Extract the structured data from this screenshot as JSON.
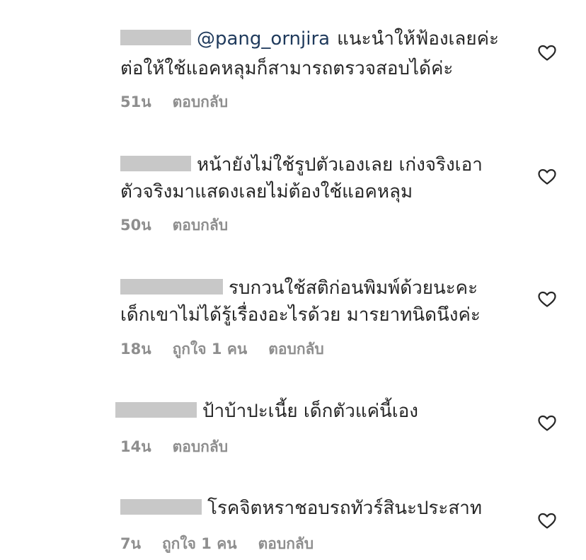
{
  "comments": [
    {
      "mention": "@pang_ornjira",
      "line1": "แนะนำให้ฟ้องเลยค่ะ",
      "line2": "ต่อให้ใช้แอคหลุมก็สามารถตรวจสอบได้ค่ะ",
      "time": "51น",
      "likes": "",
      "reply": "ตอบกลับ"
    },
    {
      "line1": "หน้ายังไม่ใช้รูปตัวเองเลย เก่งจริงเอา",
      "line2": "ตัวจริงมาแสดงเลยไม่ต้องใช้แอคหลุม",
      "time": "50น",
      "likes": "",
      "reply": "ตอบกลับ"
    },
    {
      "line1": "รบกวนใช้สติก่อนพิมพ์ด้วยนะคะ",
      "line2": "เด็กเขาไม่ได้รู้เรื่องอะไรด้วย มารยาทนิดนึงค่ะ",
      "time": "18น",
      "likes": "ถูกใจ 1 คน",
      "reply": "ตอบกลับ"
    },
    {
      "line1": "ป้าบ้าปะเนี้ย เด็กตัวแค่นี้เอง",
      "line2": "",
      "time": "14น",
      "likes": "",
      "reply": "ตอบกลับ"
    },
    {
      "line1": "โรคจิตหราชอบรถทัวร์สินะประสาท",
      "line2": "",
      "time": "7น",
      "likes": "ถูกใจ 1 คน",
      "reply": "ตอบกลับ"
    }
  ],
  "icons": {
    "like": "heart-outline-icon"
  },
  "colors": {
    "text": "#262626",
    "meta": "#8e8e8e",
    "mention": "#1f3a5c",
    "redaction": "#c8c8c8"
  }
}
